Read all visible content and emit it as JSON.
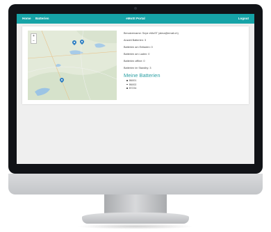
{
  "navbar": {
    "home_label": "Home",
    "batteries_label": "Batterien",
    "title": "eMoSt Portal",
    "logout_label": "Logout"
  },
  "map": {
    "zoom_in": "+",
    "zoom_out": "−"
  },
  "info": {
    "lines": [
      "Benutzername: Sepe eMoST (alma@email.ch)",
      "Anzahl Batterien: 3",
      "Batterien am Entladen: 0",
      "Batterien am Laden: 0",
      "Batterien offline: 0",
      "Batterien im Standby: 3"
    ],
    "heading": "Meine Batterien",
    "batteries": [
      "B6001",
      "B6002",
      "B7234"
    ]
  },
  "colors": {
    "accent": "#16a3a7",
    "heading": "#2a9fa3",
    "marker": "#2f7fc2"
  }
}
